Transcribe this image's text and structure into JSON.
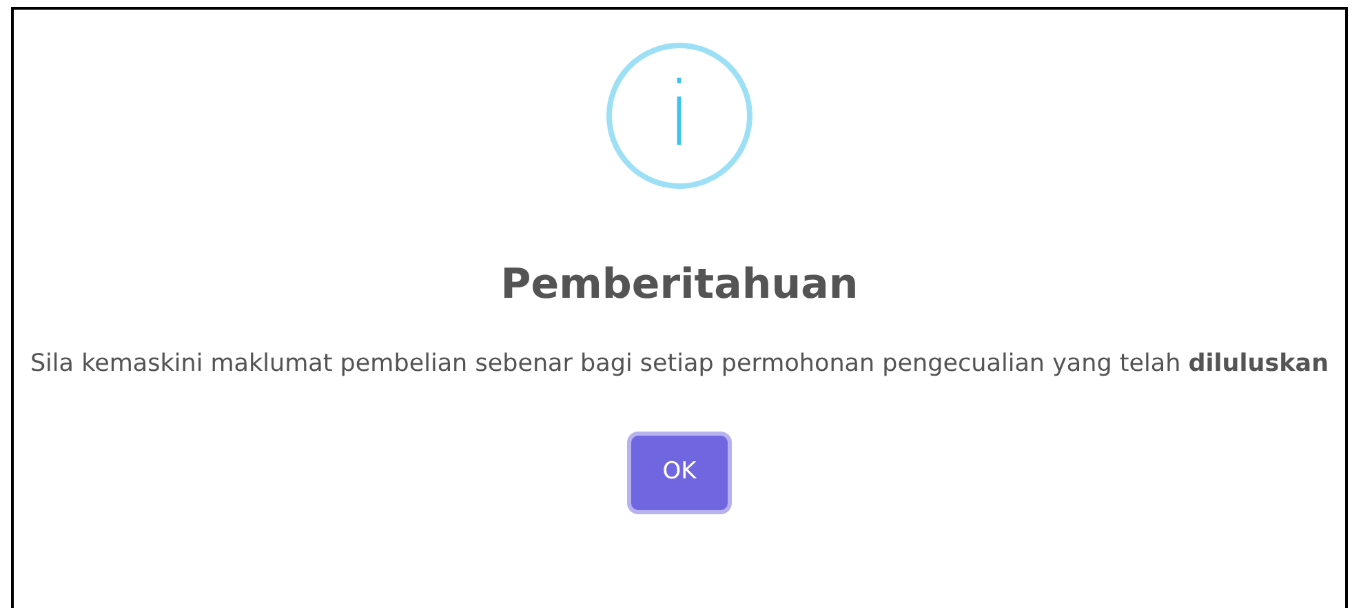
{
  "dialog": {
    "icon": "i",
    "title": "Pemberitahuan",
    "message": "Sila kemaskini maklumat pembelian sebenar bagi setiap permohonan pengecualian yang telah **diluluskan**",
    "buttons": [
      {
        "label": "OK",
        "focused": true
      }
    ]
  }
}
